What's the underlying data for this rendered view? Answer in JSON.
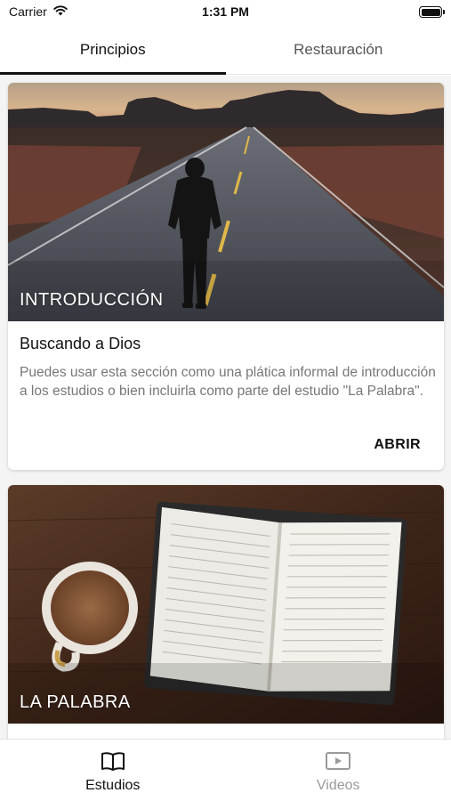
{
  "status_bar": {
    "carrier": "Carrier",
    "time": "1:31 PM",
    "wifi_icon": "wifi-icon",
    "battery_icon": "battery-icon"
  },
  "tabs": [
    {
      "label": "Principios",
      "active": true
    },
    {
      "label": "Restauración",
      "active": false
    }
  ],
  "cards": [
    {
      "overline": "INTRODUCCIÓN",
      "title": "Buscando a Dios",
      "description": "Puedes usar esta sección como una plática informal de introducción a los estudios o bien incluirla como parte del estudio \"La Palabra\".",
      "action": "ABRIR",
      "image": "road-person-walking-image"
    },
    {
      "overline": "LA PALABRA",
      "image": "open-bible-coffee-image"
    }
  ],
  "bottom_nav": {
    "items": [
      {
        "label": "Estudios",
        "icon": "book-icon",
        "active": true
      },
      {
        "label": "Videos",
        "icon": "video-play-icon",
        "active": false
      }
    ]
  },
  "colors": {
    "active_text": "#111111",
    "inactive_text": "#9a9a9a",
    "body_text": "#777777",
    "background": "#f4f4f4"
  }
}
